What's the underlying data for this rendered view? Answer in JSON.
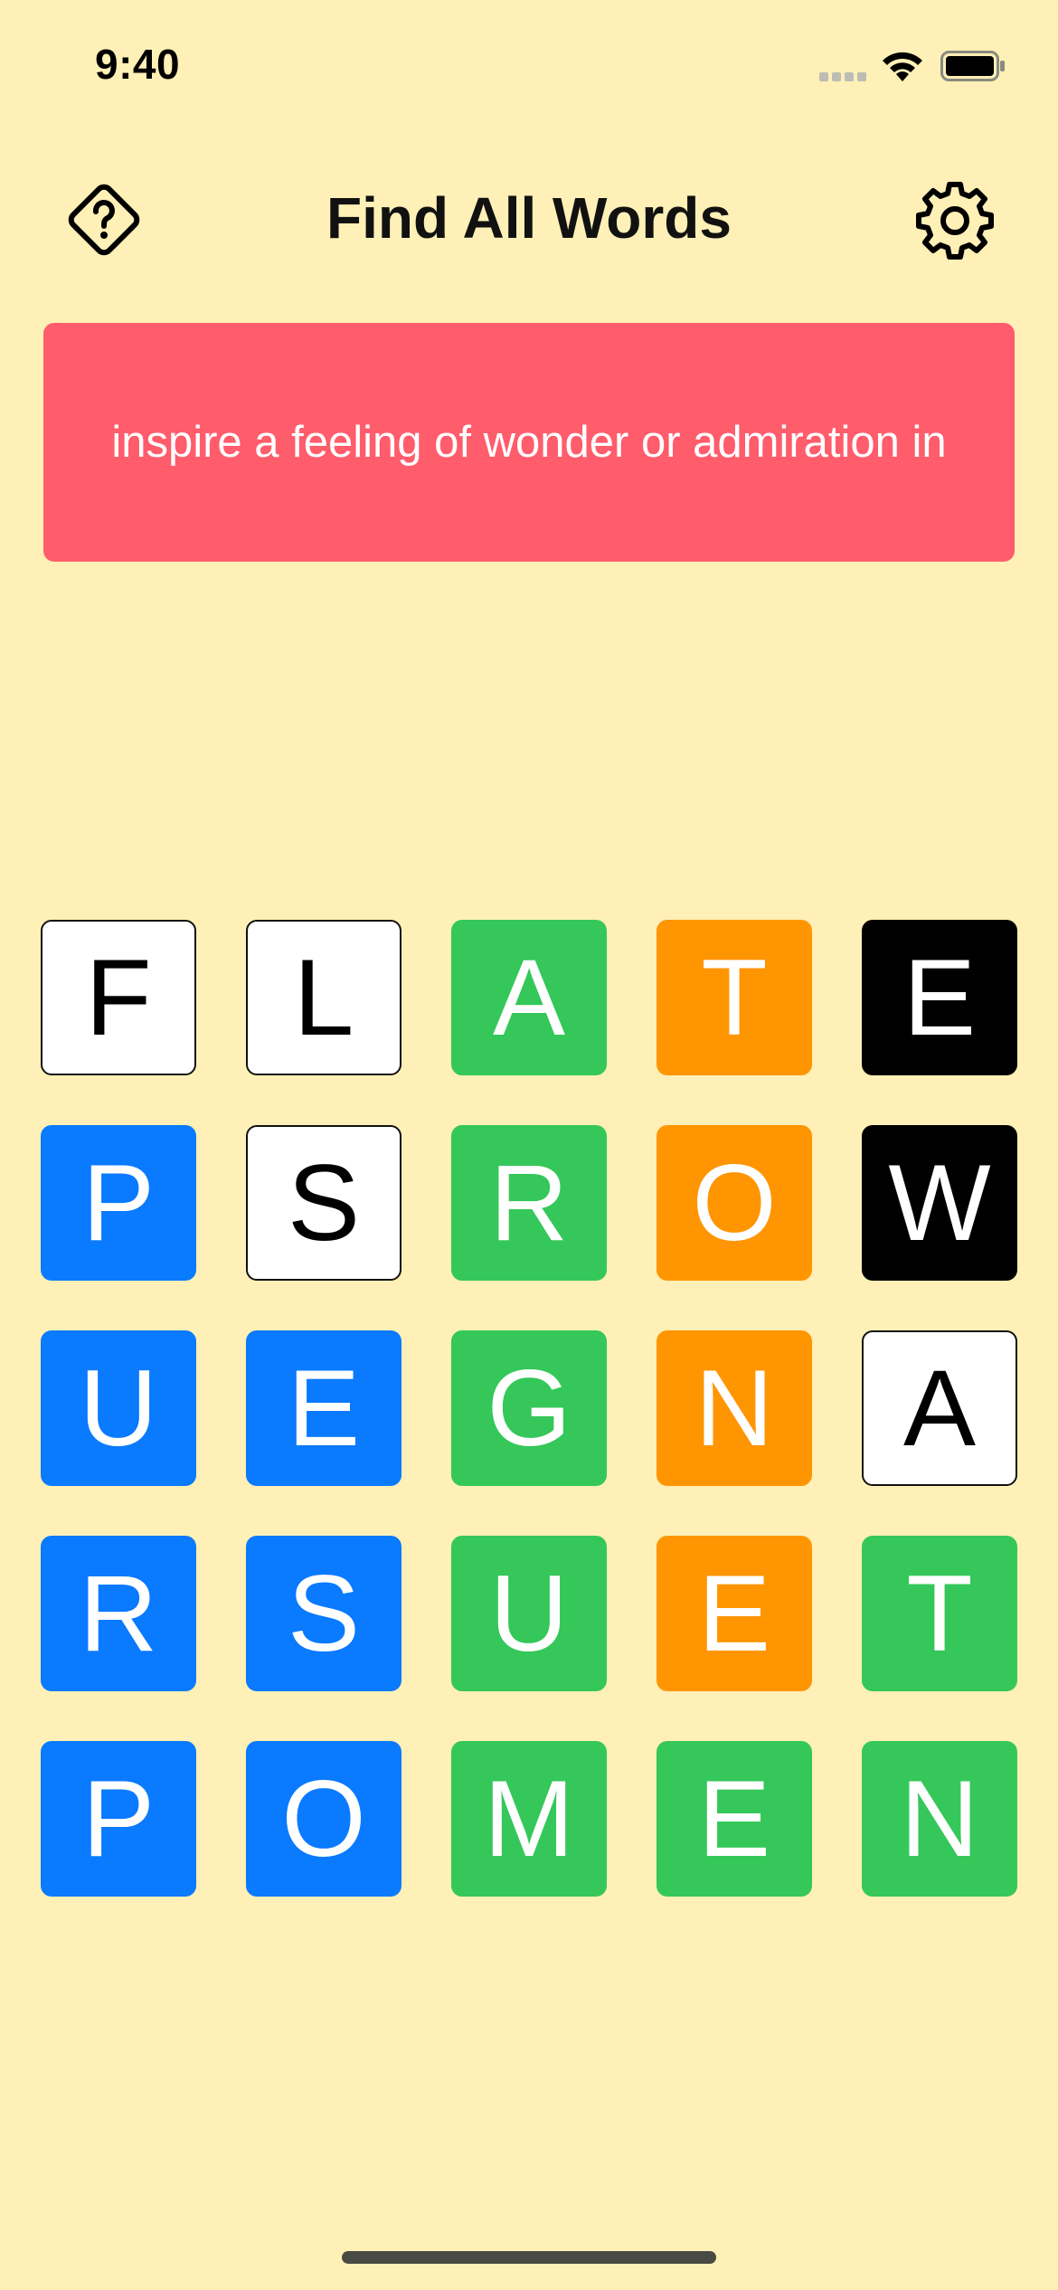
{
  "status_bar": {
    "time": "9:40",
    "signal_icon": "cellular-signal-icon",
    "wifi_icon": "wifi-icon",
    "battery_icon": "battery-icon"
  },
  "header": {
    "title": "Find All Words",
    "help_icon": "help-diamond-icon",
    "settings_icon": "gear-icon"
  },
  "clue": {
    "text": "inspire a feeling of wonder or admiration in",
    "color": "#FF5C6C"
  },
  "colors": {
    "background": "#FEF0B6",
    "blue": "#0A7AFF",
    "green": "#35C75A",
    "orange": "#FF9500",
    "black": "#000000",
    "empty": "#FFFFFF"
  },
  "grid": {
    "rows": [
      [
        {
          "letter": "F",
          "state": "empty"
        },
        {
          "letter": "L",
          "state": "empty"
        },
        {
          "letter": "A",
          "state": "green"
        },
        {
          "letter": "T",
          "state": "orange"
        },
        {
          "letter": "E",
          "state": "black"
        }
      ],
      [
        {
          "letter": "P",
          "state": "blue"
        },
        {
          "letter": "S",
          "state": "empty"
        },
        {
          "letter": "R",
          "state": "green"
        },
        {
          "letter": "O",
          "state": "orange"
        },
        {
          "letter": "W",
          "state": "black"
        }
      ],
      [
        {
          "letter": "U",
          "state": "blue"
        },
        {
          "letter": "E",
          "state": "blue"
        },
        {
          "letter": "G",
          "state": "green"
        },
        {
          "letter": "N",
          "state": "orange"
        },
        {
          "letter": "A",
          "state": "empty"
        }
      ],
      [
        {
          "letter": "R",
          "state": "blue"
        },
        {
          "letter": "S",
          "state": "blue"
        },
        {
          "letter": "U",
          "state": "green"
        },
        {
          "letter": "E",
          "state": "orange"
        },
        {
          "letter": "T",
          "state": "green"
        }
      ],
      [
        {
          "letter": "P",
          "state": "blue"
        },
        {
          "letter": "O",
          "state": "blue"
        },
        {
          "letter": "M",
          "state": "green"
        },
        {
          "letter": "E",
          "state": "green"
        },
        {
          "letter": "N",
          "state": "green"
        }
      ]
    ]
  }
}
